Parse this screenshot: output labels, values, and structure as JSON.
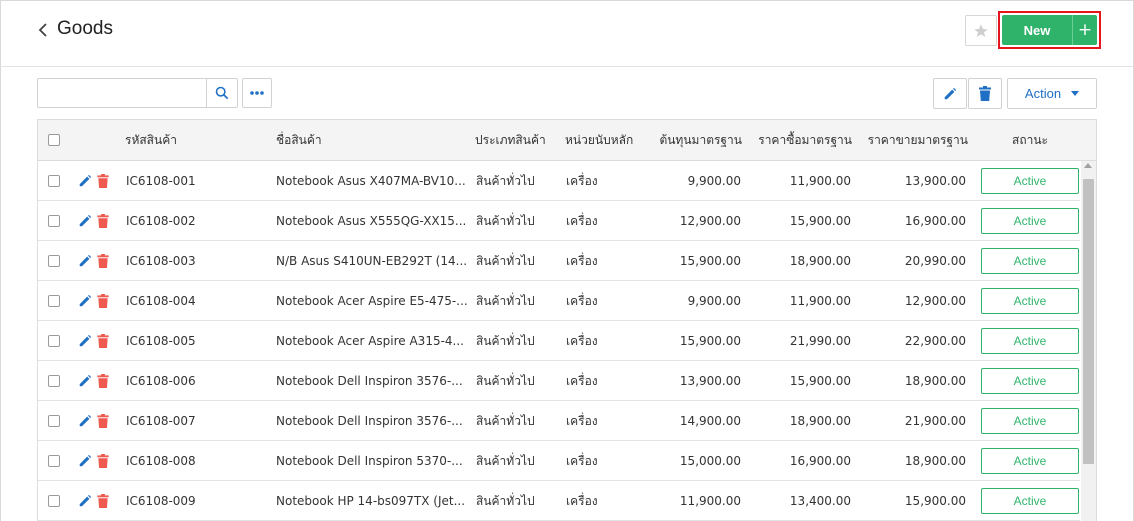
{
  "header": {
    "title": "Goods",
    "new_label": "New",
    "plus_label": "+"
  },
  "toolbar": {
    "search_placeholder": "",
    "action_label": "Action"
  },
  "table": {
    "columns": [
      "รหัสสินค้า",
      "ชื่อสินค้า",
      "ประเภทสินค้า",
      "หน่วยนับหลัก",
      "ต้นทุนมาตรฐาน",
      "ราคาซื้อมาตรฐาน",
      "ราคาขายมาตรฐาน",
      "สถานะ"
    ],
    "rows": [
      {
        "code": "IC6108-001",
        "name": "Notebook Asus X407MA-BV10...",
        "type": "สินค้าทั่วไป",
        "unit": "เครื่อง",
        "cost": "9,900.00",
        "buy": "11,900.00",
        "sell": "13,900.00",
        "status": "Active"
      },
      {
        "code": "IC6108-002",
        "name": "Notebook Asus X555QG-XX15...",
        "type": "สินค้าทั่วไป",
        "unit": "เครื่อง",
        "cost": "12,900.00",
        "buy": "15,900.00",
        "sell": "16,900.00",
        "status": "Active"
      },
      {
        "code": "IC6108-003",
        "name": "N/B Asus S410UN-EB292T (14...",
        "type": "สินค้าทั่วไป",
        "unit": "เครื่อง",
        "cost": "15,900.00",
        "buy": "18,900.00",
        "sell": "20,990.00",
        "status": "Active"
      },
      {
        "code": "IC6108-004",
        "name": "Notebook Acer Aspire E5-475-...",
        "type": "สินค้าทั่วไป",
        "unit": "เครื่อง",
        "cost": "9,900.00",
        "buy": "11,900.00",
        "sell": "12,900.00",
        "status": "Active"
      },
      {
        "code": "IC6108-005",
        "name": "Notebook Acer Aspire A315-4...",
        "type": "สินค้าทั่วไป",
        "unit": "เครื่อง",
        "cost": "15,900.00",
        "buy": "21,990.00",
        "sell": "22,900.00",
        "status": "Active"
      },
      {
        "code": "IC6108-006",
        "name": "Notebook Dell Inspiron 3576-...",
        "type": "สินค้าทั่วไป",
        "unit": "เครื่อง",
        "cost": "13,900.00",
        "buy": "15,900.00",
        "sell": "18,900.00",
        "status": "Active"
      },
      {
        "code": "IC6108-007",
        "name": "Notebook Dell Inspiron 3576-...",
        "type": "สินค้าทั่วไป",
        "unit": "เครื่อง",
        "cost": "14,900.00",
        "buy": "18,900.00",
        "sell": "21,900.00",
        "status": "Active"
      },
      {
        "code": "IC6108-008",
        "name": "Notebook Dell Inspiron 5370-...",
        "type": "สินค้าทั่วไป",
        "unit": "เครื่อง",
        "cost": "15,000.00",
        "buy": "16,900.00",
        "sell": "18,900.00",
        "status": "Active"
      },
      {
        "code": "IC6108-009",
        "name": "Notebook HP 14-bs097TX (Jet...",
        "type": "สินค้าทั่วไป",
        "unit": "เครื่อง",
        "cost": "11,900.00",
        "buy": "13,400.00",
        "sell": "15,900.00",
        "status": "Active"
      }
    ]
  },
  "colors": {
    "accent_green": "#2fb36b",
    "highlight_red": "#e4161b",
    "link_blue": "#1f6fc5",
    "delete_red": "#f0594f"
  },
  "icons": [
    "chevron-left-icon",
    "star-icon",
    "plus-icon",
    "search-icon",
    "more-dots-icon",
    "pencil-icon",
    "trash-icon",
    "caret-down-icon"
  ]
}
